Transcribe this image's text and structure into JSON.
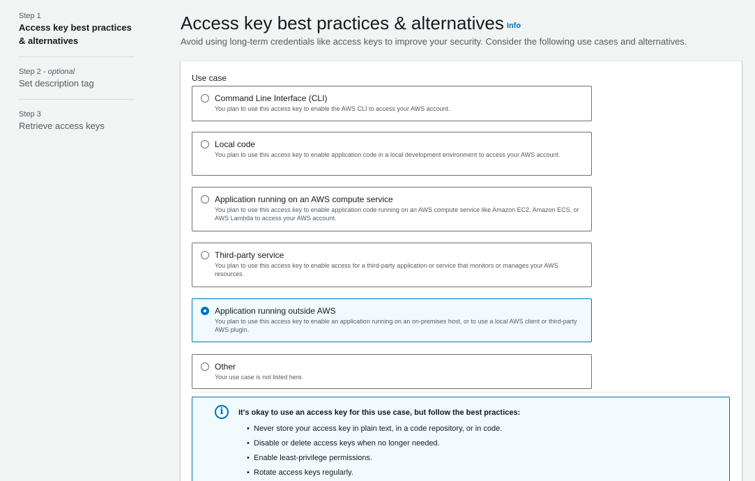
{
  "steps": [
    {
      "number": "Step 1",
      "optional": "",
      "title": "Access key best practices & alternatives"
    },
    {
      "number": "Step 2 - ",
      "optional": "optional",
      "title": "Set description tag"
    },
    {
      "number": "Step 3",
      "optional": "",
      "title": "Retrieve access keys"
    }
  ],
  "header": {
    "title": "Access key best practices & alternatives",
    "info": "Info",
    "description": "Avoid using long-term credentials like access keys to improve your security. Consider the following use cases and alternatives."
  },
  "use_case": {
    "label": "Use case",
    "options": [
      {
        "title": "Command Line Interface (CLI)",
        "desc": "You plan to use this access key to enable the AWS CLI to access your AWS account.",
        "selected": false
      },
      {
        "title": "Local code",
        "desc": "You plan to use this access key to enable application code in a local development environment to access your AWS account.",
        "selected": false
      },
      {
        "title": "Application running on an AWS compute service",
        "desc": "You plan to use this access key to enable application code running on an AWS compute service like Amazon EC2, Amazon ECS, or AWS Lambda to access your AWS account.",
        "selected": false
      },
      {
        "title": "Third-party service",
        "desc": "You plan to use this access key to enable access for a third-party application or service that monitors or manages your AWS resources.",
        "selected": false
      },
      {
        "title": "Application running outside AWS",
        "desc": "You plan to use this access key to enable an application running on an on-premises host, or to use a local AWS client or third-party AWS plugin.",
        "selected": true
      },
      {
        "title": "Other",
        "desc": "Your use case is not listed here.",
        "selected": false
      }
    ]
  },
  "alert": {
    "icon": "info-icon",
    "title": "It's okay to use an access key for this use case, but follow the best practices:",
    "items": [
      "Never store your access key in plain text, in a code repository, or in code.",
      "Disable or delete access keys when no longer needed.",
      "Enable least-privilege permissions.",
      "Rotate access keys regularly."
    ]
  },
  "colors": {
    "accent": "#0073bb",
    "selected_bg": "#f1faff",
    "page_bg": "#f2f3f3"
  }
}
